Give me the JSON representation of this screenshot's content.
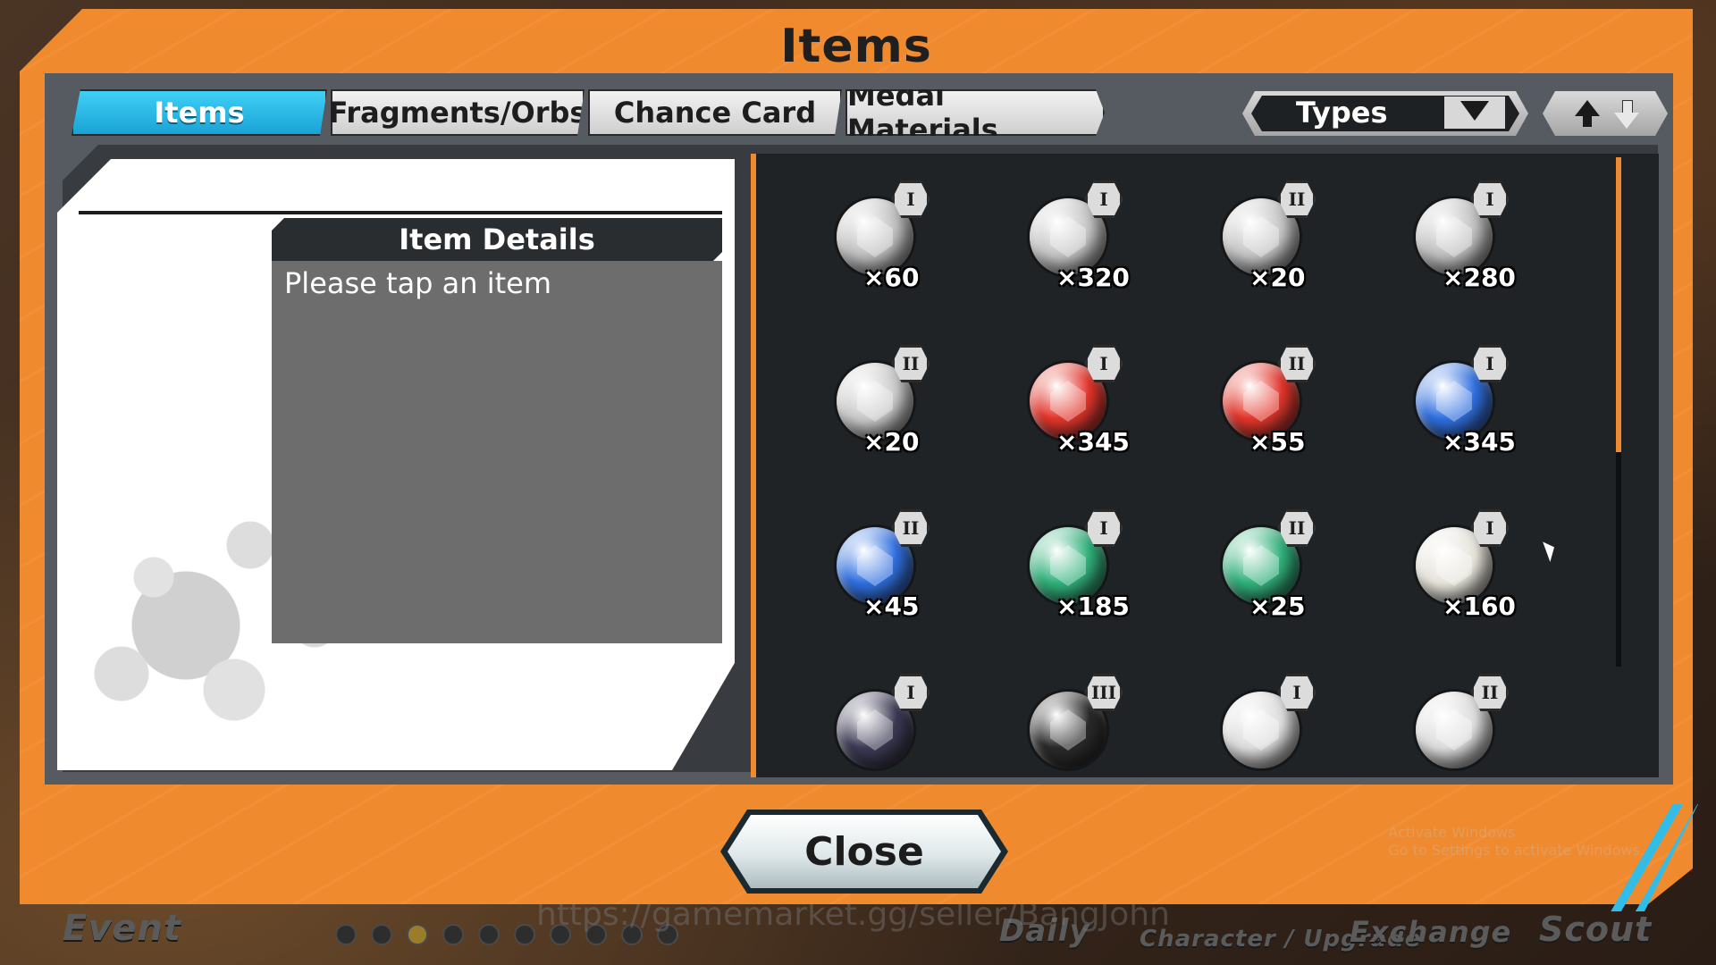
{
  "dialog": {
    "title": "Items",
    "tabs": [
      {
        "label": "Items",
        "active": true
      },
      {
        "label": "Fragments/Orbs",
        "active": false
      },
      {
        "label": "Chance Card",
        "active": false
      },
      {
        "label": "Medal Materials",
        "active": false
      }
    ],
    "filter": {
      "label": "Types"
    },
    "details": {
      "header": "Item Details",
      "placeholder": "Please tap an item"
    },
    "close_label": "Close"
  },
  "items": [
    {
      "icon": "silver-boot-icon",
      "tier": "I",
      "count": "×60",
      "color": "#bfbfbf"
    },
    {
      "icon": "silver-shield-icon",
      "tier": "I",
      "count": "×320",
      "color": "#c4c4c4"
    },
    {
      "icon": "silver-shield-icon",
      "tier": "II",
      "count": "×20",
      "color": "#c4c4c4"
    },
    {
      "icon": "silver-boot-icon",
      "tier": "I",
      "count": "×280",
      "color": "#bfbfbf"
    },
    {
      "icon": "silver-boot-icon",
      "tier": "II",
      "count": "×20",
      "color": "#c9c9c9"
    },
    {
      "icon": "red-gem-orb-icon",
      "tier": "I",
      "count": "×345",
      "color": "#e2342a"
    },
    {
      "icon": "red-gem-orb-icon",
      "tier": "II",
      "count": "×55",
      "color": "#e2342a"
    },
    {
      "icon": "blue-gem-orb-icon",
      "tier": "I",
      "count": "×345",
      "color": "#2f6fe0"
    },
    {
      "icon": "blue-gem-orb-icon",
      "tier": "II",
      "count": "×45",
      "color": "#2f6fe0"
    },
    {
      "icon": "green-gem-orb-icon",
      "tier": "I",
      "count": "×185",
      "color": "#2fb07a"
    },
    {
      "icon": "green-gem-orb-icon",
      "tier": "II",
      "count": "×25",
      "color": "#2fb07a"
    },
    {
      "icon": "rainbow-gem-orb-icon",
      "tier": "I",
      "count": "×160",
      "color": "#e6e3da"
    },
    {
      "icon": "dark-gem-orb-icon",
      "tier": "I",
      "count": "",
      "color": "#3c3a55"
    },
    {
      "icon": "black-gold-orb-icon",
      "tier": "III",
      "count": "",
      "color": "#2a2a2a"
    },
    {
      "icon": "heart-medal-icon",
      "tier": "I",
      "count": "",
      "color": "#dcdcdc"
    },
    {
      "icon": "heart-medal-icon",
      "tier": "II",
      "count": "",
      "color": "#dcdcdc"
    }
  ],
  "background": {
    "nav": [
      {
        "label": "Event"
      },
      {
        "label": "Daily"
      },
      {
        "label": "Character / Upgrade"
      },
      {
        "label": "Exchange"
      },
      {
        "label": "Scout"
      }
    ],
    "watermark": "https://gamemarket.gg/seller/BangJohn",
    "activate_windows": [
      "Activate Windows",
      "Go to Settings to activate Windows."
    ]
  },
  "colors": {
    "accent": "#f08a2e",
    "tab_active": "#1aa3d6",
    "panel": "#1f2326"
  }
}
